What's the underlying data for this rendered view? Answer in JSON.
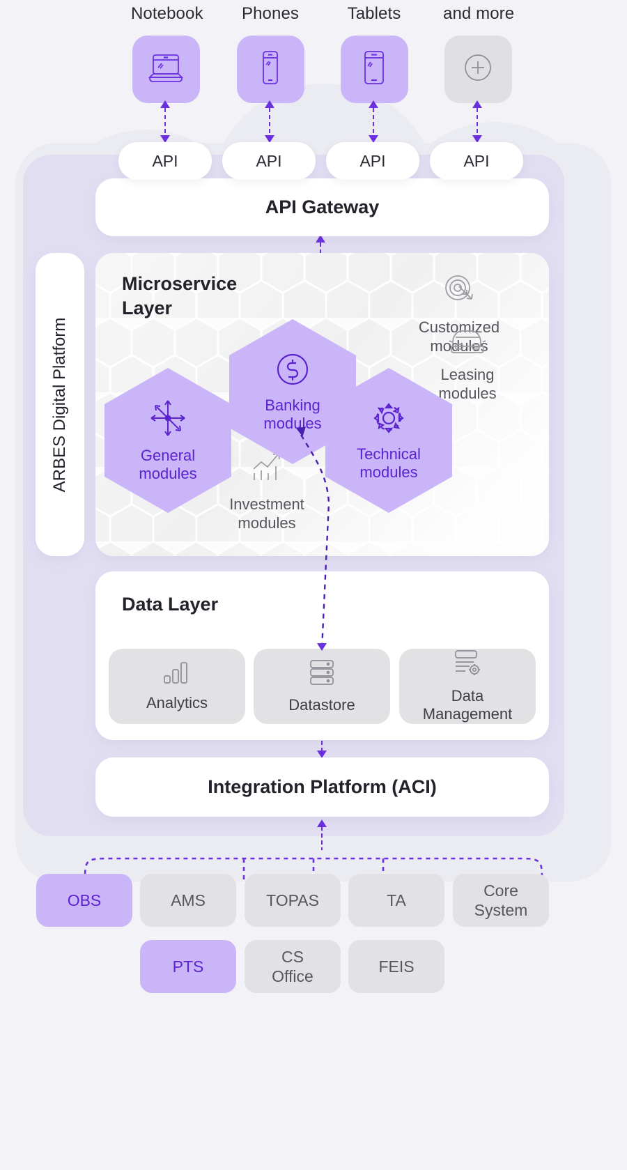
{
  "devices": [
    {
      "label": "Notebook",
      "icon": "laptop-icon",
      "accent": true
    },
    {
      "label": "Phones",
      "icon": "phone-icon",
      "accent": true
    },
    {
      "label": "Tablets",
      "icon": "tablet-icon",
      "accent": true
    },
    {
      "label": "and more",
      "icon": "plus-circle-icon",
      "accent": false
    }
  ],
  "api_pills": [
    "API",
    "API",
    "API",
    "API"
  ],
  "gateway": {
    "title": "API Gateway"
  },
  "platform": {
    "vertical_label": "ARBES Digital Platform"
  },
  "microservice": {
    "title_line1": "Microservice",
    "title_line2": "Layer",
    "hexes": [
      {
        "label_line1": "General",
        "label_line2": "modules",
        "icon": "nodes-arrows-icon",
        "active": true
      },
      {
        "label_line1": "Banking",
        "label_line2": "modules",
        "icon": "dollar-circle-icon",
        "active": true
      },
      {
        "label_line1": "Technical",
        "label_line2": "modules",
        "icon": "gear-icon",
        "active": true
      }
    ],
    "soft_cells": [
      {
        "label_line1": "Customized",
        "label_line2": "modules",
        "icon": "target-arrow-icon"
      },
      {
        "label_line1": "Leasing",
        "label_line2": "modules",
        "icon": "car-icon"
      },
      {
        "label_line1": "Investment",
        "label_line2": "modules",
        "icon": "chart-growth-icon"
      }
    ]
  },
  "data_layer": {
    "title": "Data Layer",
    "boxes": [
      {
        "label_line1": "Analytics",
        "label_line2": "",
        "icon": "bar-chart-icon"
      },
      {
        "label_line1": "Datastore",
        "label_line2": "",
        "icon": "database-icon"
      },
      {
        "label_line1": "Data",
        "label_line2": "Management",
        "icon": "database-gear-icon"
      }
    ]
  },
  "integration": {
    "title": "Integration Platform (ACI)"
  },
  "systems_row1": [
    {
      "label_line1": "OBS",
      "label_line2": "",
      "accent": true
    },
    {
      "label_line1": "AMS",
      "label_line2": "",
      "accent": false
    },
    {
      "label_line1": "TOPAS",
      "label_line2": "",
      "accent": false
    },
    {
      "label_line1": "TA",
      "label_line2": "",
      "accent": false
    },
    {
      "label_line1": "Core",
      "label_line2": "System",
      "accent": false
    }
  ],
  "systems_row2": [
    {
      "label_line1": "PTS",
      "label_line2": "",
      "accent": true
    },
    {
      "label_line1": "CS",
      "label_line2": "Office",
      "accent": false
    },
    {
      "label_line1": "FEIS",
      "label_line2": "",
      "accent": false
    }
  ],
  "colors": {
    "accent_purple": "#6b30e0",
    "hex_fill": "#c9b5f7",
    "text_purple": "#5a23cf",
    "platform_bg": "#e2def2",
    "page_bg": "#f2f2f7",
    "muted_tile": "#e0e0e3"
  }
}
